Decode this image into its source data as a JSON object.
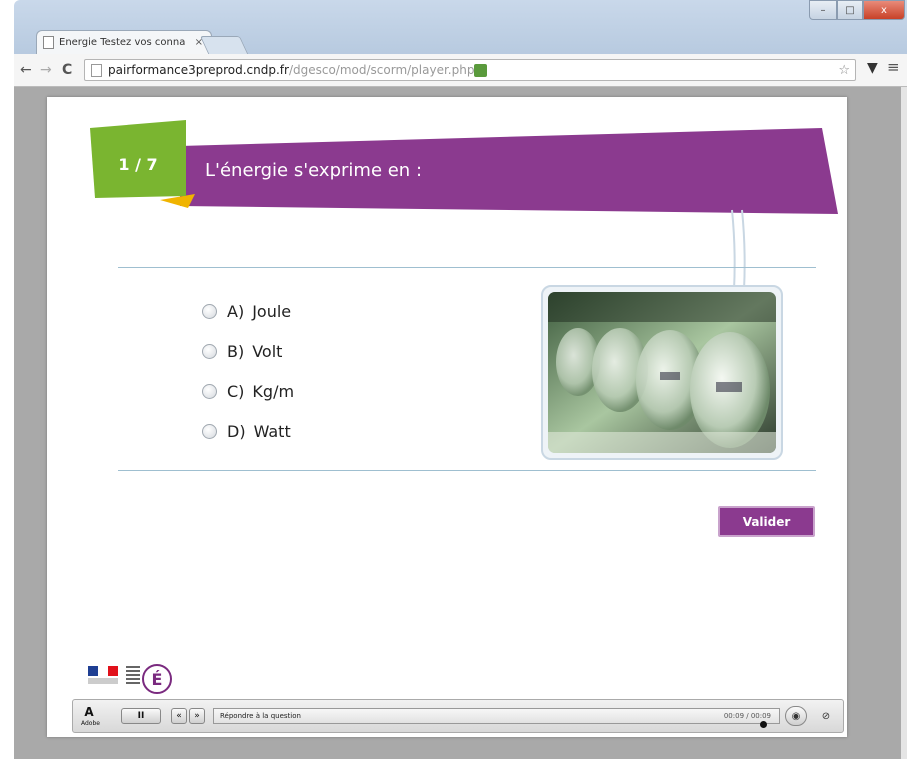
{
  "browser": {
    "tab_title": "Energie Testez vos conna",
    "tab_close": "×",
    "url_host": "pairformance3preprod.cndp.fr",
    "url_path": "/dgesco/mod/scorm/player.php",
    "nav_back": "←",
    "nav_forward": "→",
    "nav_reload": "C",
    "star_icon": "☆",
    "menu_icon": "≡",
    "pocket_icon": "▼",
    "win_min": "–",
    "win_max": "□",
    "win_close": "x"
  },
  "quiz": {
    "question_number": "1 / 7",
    "question": "L'énergie s'exprime en :",
    "options": [
      {
        "letter": "A)",
        "label": "Joule"
      },
      {
        "letter": "B)",
        "label": "Volt"
      },
      {
        "letter": "C)",
        "label": "Kg/m"
      },
      {
        "letter": "D)",
        "label": "Watt"
      }
    ],
    "submit_label": "Valider",
    "image_icon": "electricity-meters-photo"
  },
  "logos": {
    "education_letter": "É"
  },
  "player": {
    "adobe_letter": "A",
    "adobe_small": "Adobe",
    "pause_label": "II",
    "prev_label": "«",
    "next_label": "»",
    "status": "Répondre à la question",
    "time": "00:09 / 00:09",
    "audio_icon": "◉",
    "extra_icon": "⊘"
  },
  "colors": {
    "banner_purple": "#8b3a8f",
    "number_green": "#7ab530",
    "accent_yellow": "#f0b400"
  }
}
